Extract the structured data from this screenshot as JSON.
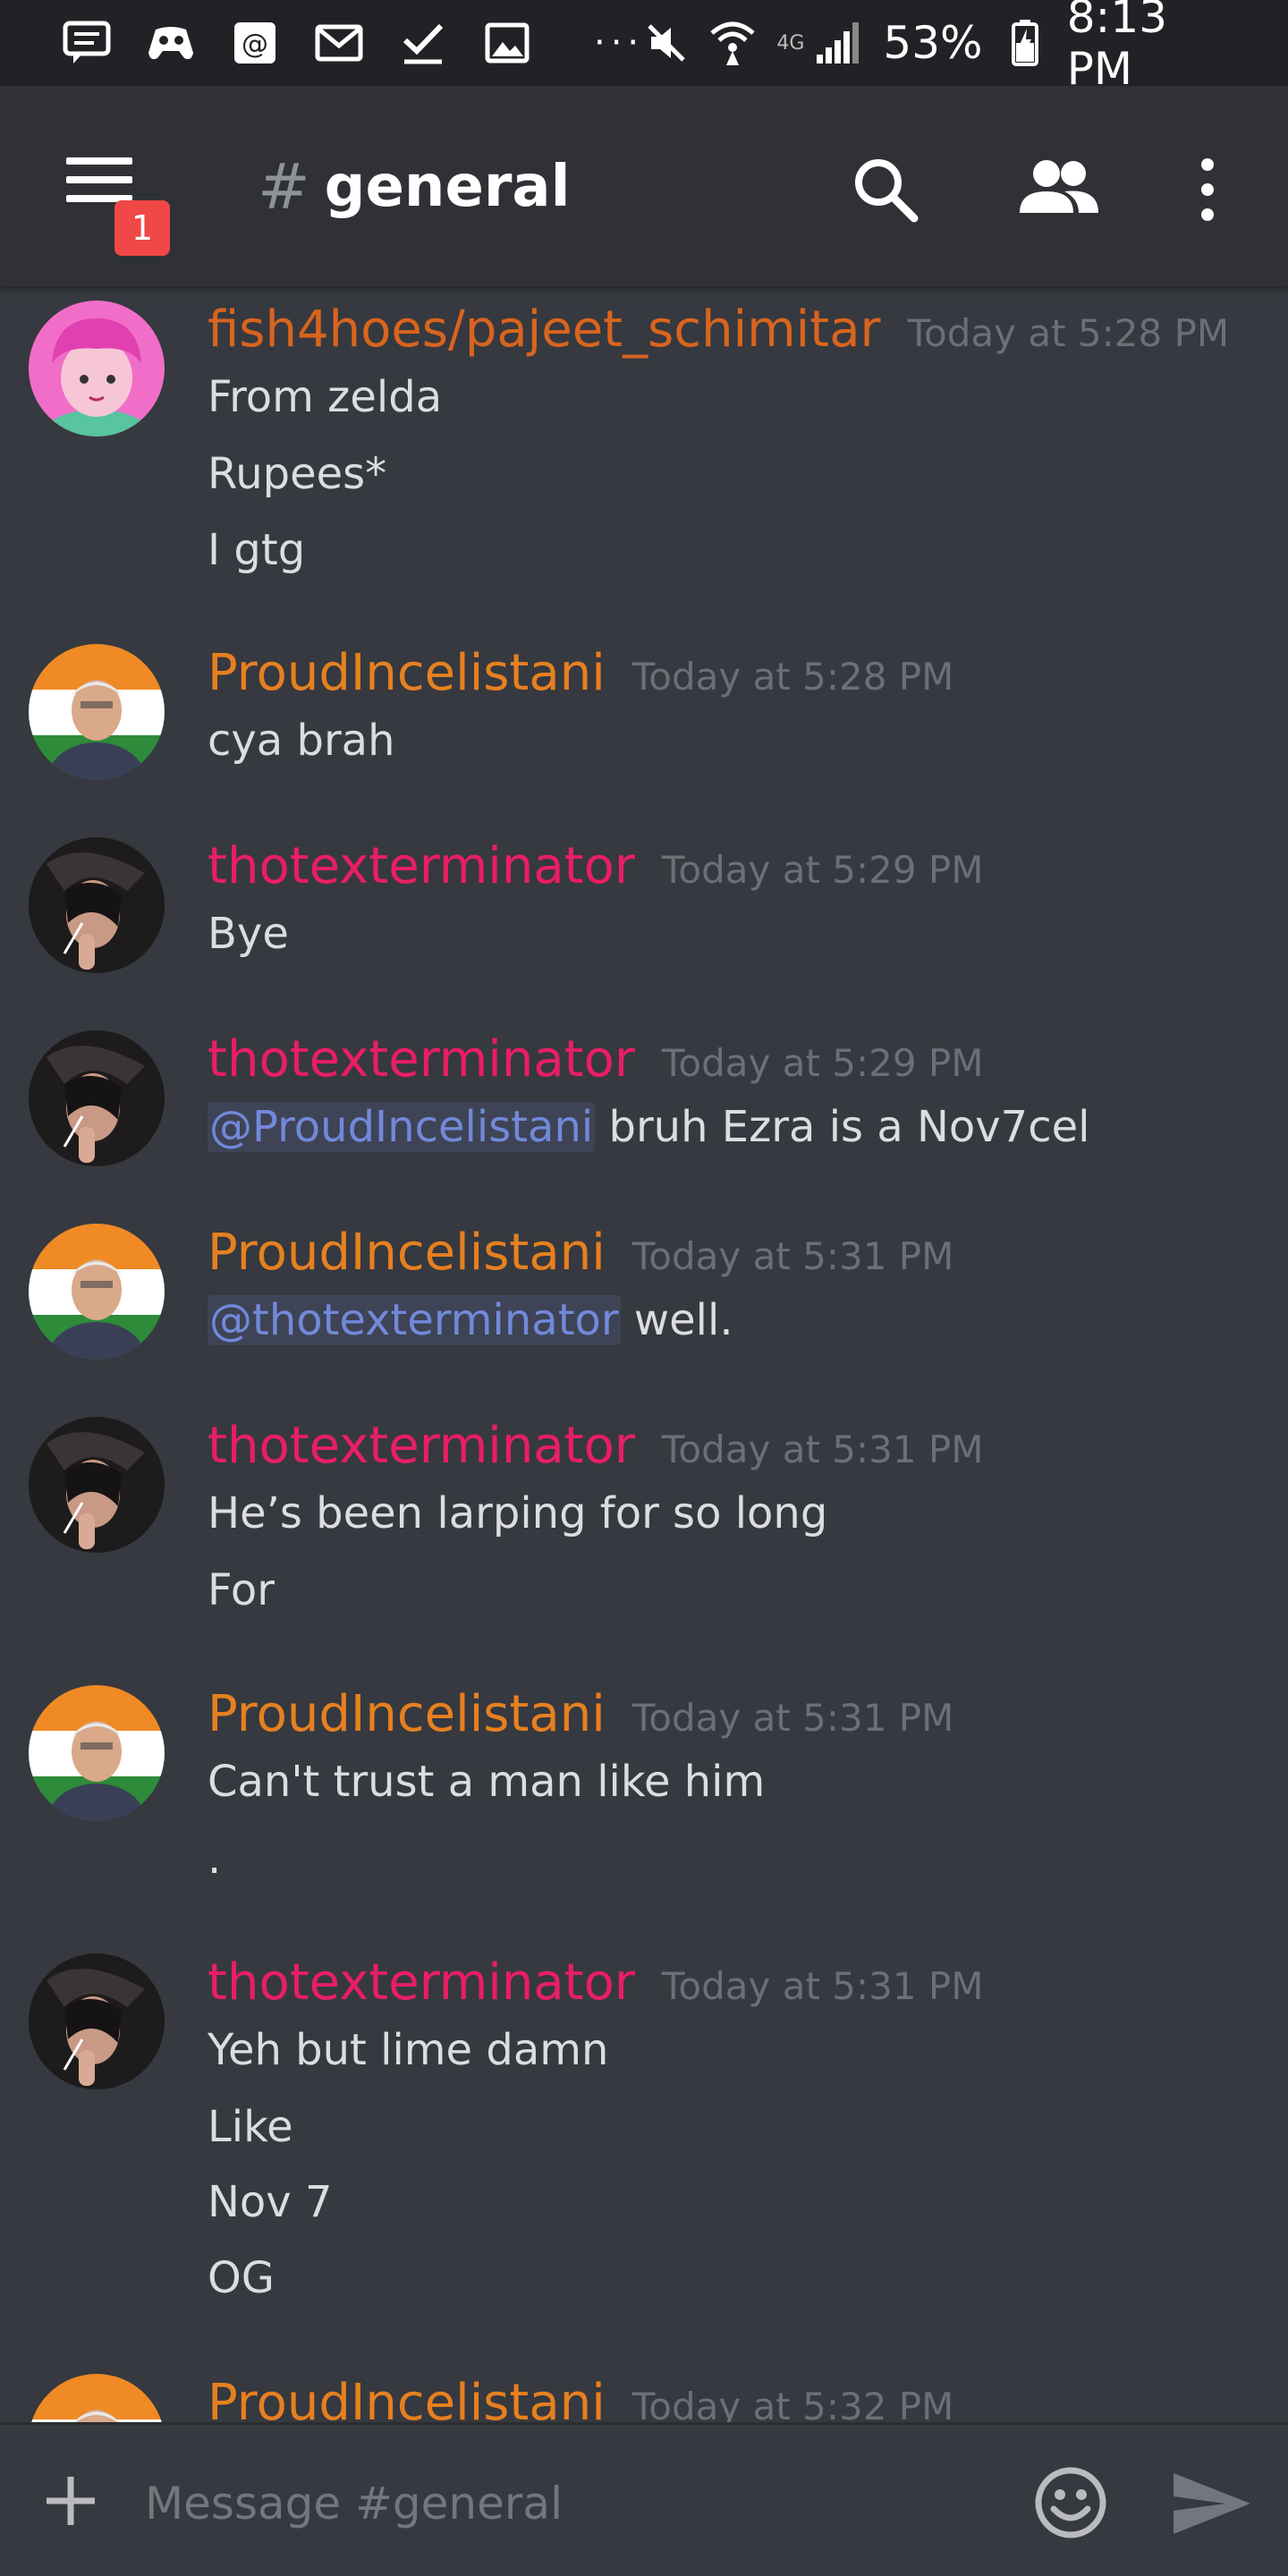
{
  "status_bar": {
    "icons": [
      "chat-bubble-icon",
      "gamepad-icon",
      "at-sign-icon",
      "gmail-icon",
      "check-icon",
      "image-icon"
    ],
    "more": "···",
    "network": "4G",
    "battery": "53%",
    "time": "8:13 PM"
  },
  "header": {
    "notification_count": "1",
    "hash": "#",
    "channel": "general"
  },
  "colors": {
    "fish4hoes": "#d9641e",
    "proudincelistani": "#e68020",
    "thotexterminator": "#e91e63",
    "mention": "#7289da"
  },
  "messages": [
    {
      "author": "fish4hoes/pajeet_schimitar",
      "timestamp": "Today at 5:28 PM",
      "lines": [
        "From zelda",
        "Rupees*",
        "I gtg"
      ]
    },
    {
      "author": "ProudIncelistani",
      "timestamp": "Today at 5:28 PM",
      "lines": [
        "cya brah"
      ]
    },
    {
      "author": "thotexterminator",
      "timestamp": "Today at 5:29 PM",
      "lines": [
        "Bye"
      ]
    },
    {
      "author": "thotexterminator",
      "timestamp": "Today at 5:29 PM",
      "mention": "@ProudIncelistani",
      "text": " bruh Ezra is a Nov7cel"
    },
    {
      "author": "ProudIncelistani",
      "timestamp": "Today at 5:31 PM",
      "mention": "@thotexterminator",
      "text": " well."
    },
    {
      "author": "thotexterminator",
      "timestamp": "Today at 5:31 PM",
      "lines": [
        "He’s been larping for so long",
        "For"
      ]
    },
    {
      "author": "ProudIncelistani",
      "timestamp": "Today at 5:31 PM",
      "lines": [
        "Can't trust a man like him",
        "."
      ]
    },
    {
      "author": "thotexterminator",
      "timestamp": "Today at 5:31 PM",
      "lines": [
        "Yeh but lime damn",
        "Like",
        "Nov 7",
        "OG"
      ]
    },
    {
      "author": "ProudIncelistani",
      "timestamp": "Today at 5:32 PM",
      "lines": []
    }
  ],
  "composer": {
    "placeholder": "Message #general"
  }
}
